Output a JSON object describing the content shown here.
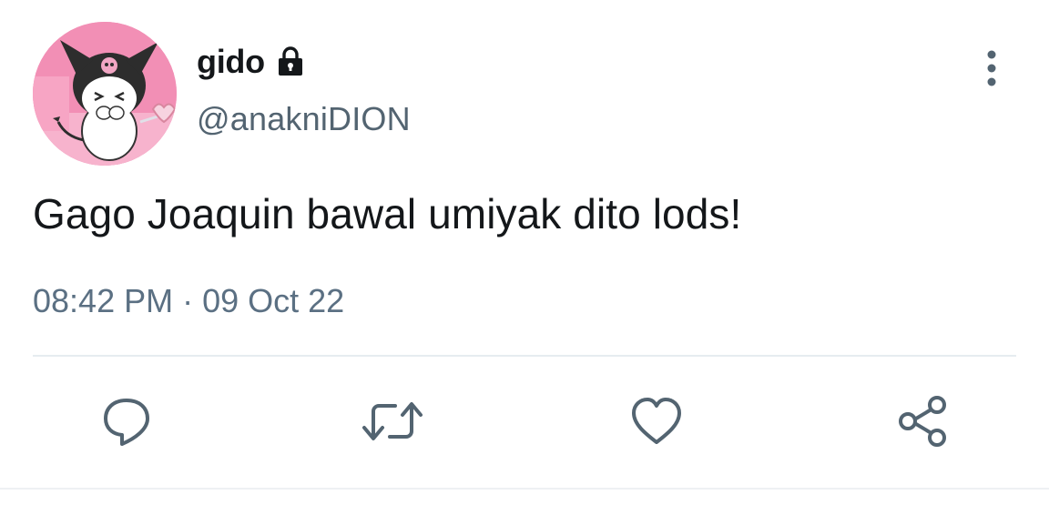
{
  "user": {
    "display_name": "gido",
    "handle": "@anakniDION",
    "protected_icon": "lock-icon",
    "avatar_icon": "avatar-cartoon-character"
  },
  "tweet": {
    "text": "Gago Joaquin bawal umiyak dito lods!",
    "time": "08:42 PM",
    "separator": "·",
    "date": "09 Oct 22"
  },
  "menu": {
    "icon": "more-vertical-icon"
  },
  "actions": [
    {
      "name": "reply",
      "icon": "reply-icon"
    },
    {
      "name": "retweet",
      "icon": "retweet-icon"
    },
    {
      "name": "like",
      "icon": "heart-icon"
    },
    {
      "name": "share",
      "icon": "share-icon"
    }
  ],
  "colors": {
    "text_primary": "#14171a",
    "text_secondary": "#536471",
    "icon_color": "#536471",
    "divider": "#e6ecf0",
    "avatar_bg": "#f28fb5"
  }
}
